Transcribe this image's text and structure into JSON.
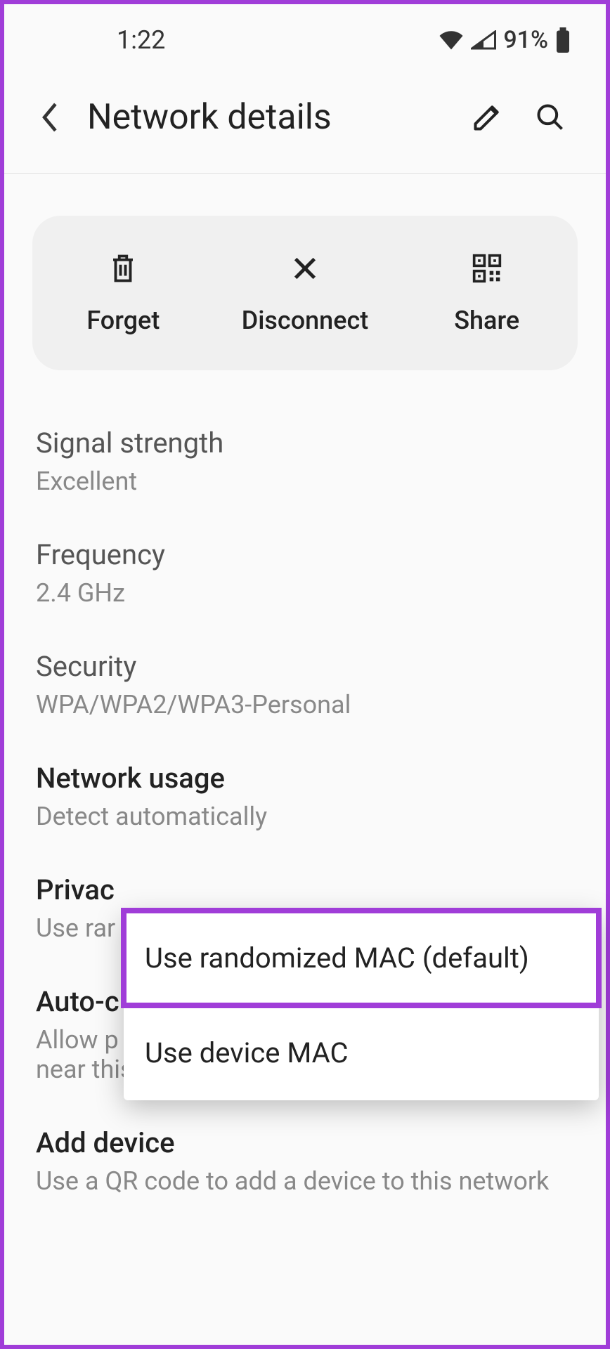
{
  "status": {
    "time": "1:22",
    "battery_pct": "91%"
  },
  "header": {
    "title": "Network details"
  },
  "actions": {
    "forget": "Forget",
    "disconnect": "Disconnect",
    "share": "Share"
  },
  "settings": {
    "signal": {
      "title": "Signal strength",
      "value": "Excellent"
    },
    "frequency": {
      "title": "Frequency",
      "value": "2.4 GHz"
    },
    "security": {
      "title": "Security",
      "value": "WPA/WPA2/WPA3-Personal"
    },
    "usage": {
      "title": "Network usage",
      "value": "Detect automatically"
    },
    "privacy": {
      "title": "Privac",
      "value": "Use rar"
    },
    "auto": {
      "title": "Auto-c",
      "value": "Allow p",
      "value2": "near this network"
    },
    "add": {
      "title": "Add device",
      "value": "Use a QR code to add a device to this network"
    }
  },
  "popup": {
    "option1": "Use randomized MAC (default)",
    "option2": "Use device MAC"
  }
}
